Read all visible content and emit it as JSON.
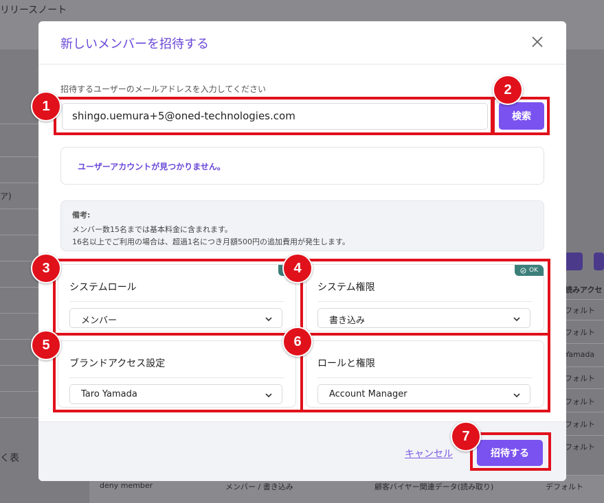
{
  "background": {
    "top_title": "リリースノート",
    "sidebar_texts": [
      "ア)",
      "く表"
    ],
    "right_texts": [
      "読みアクセ",
      "フォルト",
      "フォルト",
      "Yamada",
      "フォルト",
      "フォルト",
      "フォルト",
      "フォルト"
    ],
    "bottom_row": [
      "deny member",
      "メンバー / 書き込み",
      "顧客バイヤー関連データ(読み取り)",
      "デフォルト"
    ]
  },
  "modal": {
    "title": "新しいメンバーを招待する",
    "email_label": "招待するユーザーのメールアドレスを入力してください",
    "email_value": "shingo.uemura+5@oned-technologies.com",
    "search_label": "検索",
    "notfound_text": "ユーザーアカウントが見つかりません。",
    "note": {
      "title": "備考:",
      "line1": "メンバー数15名までは基本料金に含まれます。",
      "line2": "16名以上でご利用の場合は、超過1名につき月額500円の追加費用が発生します。"
    },
    "cards": [
      {
        "title": "システムロール",
        "value": "メンバー",
        "badge": ""
      },
      {
        "title": "システム権限",
        "value": "書き込み",
        "badge": "OK"
      },
      {
        "title": "ブランドアクセス設定",
        "value": "Taro Yamada",
        "badge": ""
      },
      {
        "title": "ロールと権限",
        "value": "Account Manager",
        "badge": ""
      }
    ],
    "cancel_label": "キャンセル",
    "invite_label": "招待する"
  },
  "annotations": [
    "1",
    "2",
    "3",
    "4",
    "5",
    "6",
    "7"
  ],
  "colors": {
    "accent": "#7a52ef",
    "title": "#6a48d8",
    "annotation_red": "#e0111b",
    "badge": "#3c7f7a"
  }
}
